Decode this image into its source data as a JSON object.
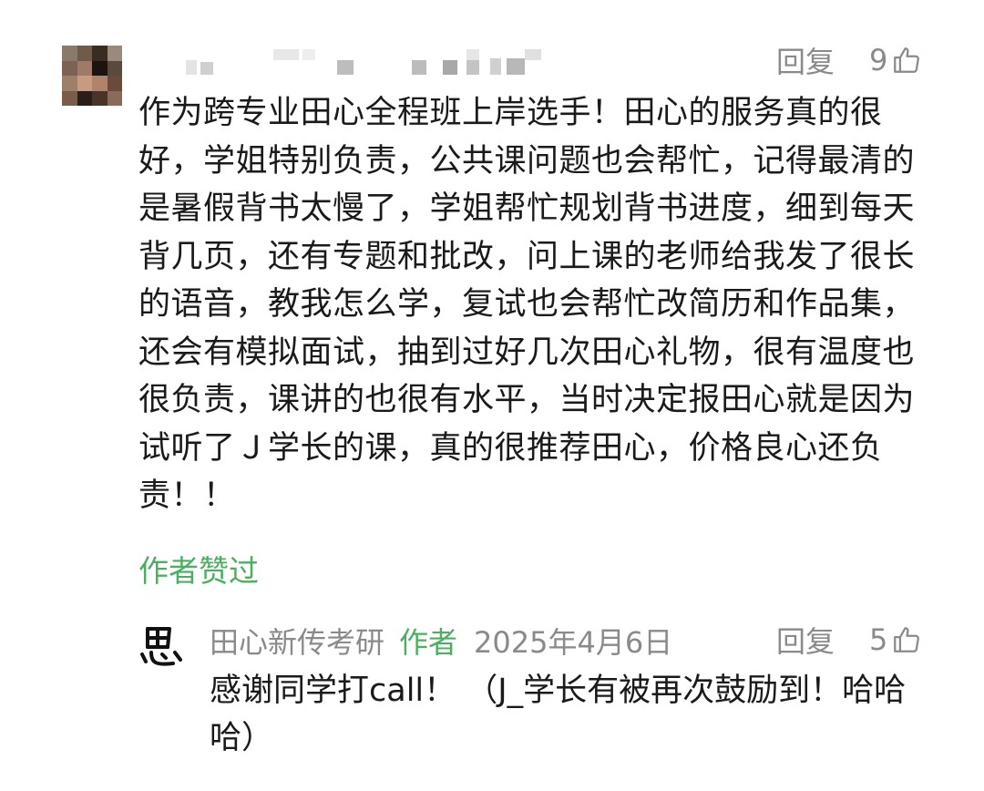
{
  "comment": {
    "reply_label": "回复",
    "like_count": "9",
    "text": "作为跨专业田心全程班上岸选手！田心的服务真的很好，学姐特别负责，公共课问题也会帮忙，记得最清的是暑假背书太慢了，学姐帮忙规划背书进度，细到每天背几页，还有专题和批改，问上课的老师给我发了很长的语音，教我怎么学，复试也会帮忙改简历和作品集，还会有模拟面试，抽到过好几次田心礼物，很有温度也很负责，课讲的也很有水平，当时决定报田心就是因为试听了Ｊ学长的课，真的很推荐田心，价格良心还负责！！",
    "author_liked": "作者赞过"
  },
  "reply": {
    "username": "田心新传考研",
    "author_tag": "作者",
    "date": "2025年4月6日",
    "reply_label": "回复",
    "like_count": "5",
    "text": "感谢同学打call！ （J_学长有被再次鼓励到！哈哈哈）"
  },
  "colors": {
    "accent_green": "#4caf60",
    "meta_gray": "#8a8a8a",
    "text": "#1a1a1a"
  },
  "icons": {
    "like": "thumbs-up-icon",
    "reply_avatar": "calligraphy-logo-icon"
  }
}
